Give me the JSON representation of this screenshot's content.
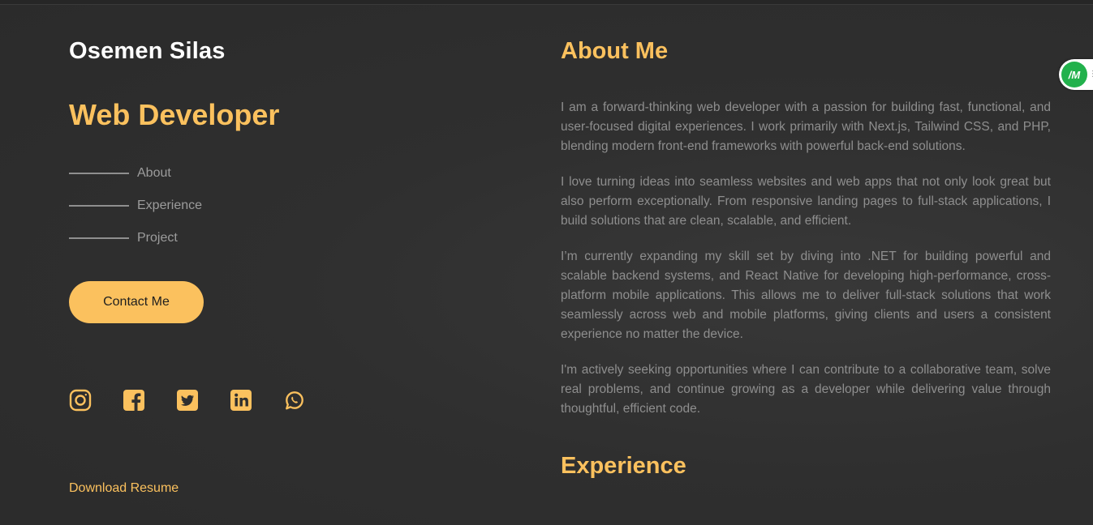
{
  "profile": {
    "name": "Osemen Silas",
    "role": "Web Developer"
  },
  "nav": {
    "items": [
      {
        "label": "About"
      },
      {
        "label": "Experience"
      },
      {
        "label": "Project"
      }
    ]
  },
  "contact": {
    "label": "Contact Me"
  },
  "socials": [
    {
      "icon": "instagram-icon"
    },
    {
      "icon": "facebook-icon"
    },
    {
      "icon": "twitter-icon"
    },
    {
      "icon": "linkedin-icon"
    },
    {
      "icon": "whatsapp-icon"
    }
  ],
  "resume": {
    "label": "Download Resume"
  },
  "about": {
    "title": "About Me",
    "paragraphs": [
      "I am a forward-thinking web developer with a passion for building fast, functional, and user-focused digital experiences. I work primarily with Next.js, Tailwind CSS, and PHP, blending modern front-end frameworks with powerful back-end solutions.",
      "I love turning ideas into seamless websites and web apps that not only look great but also perform exceptionally. From responsive landing pages to full-stack applications, I build solutions that are clean, scalable, and efficient.",
      "I’m currently expanding my skill set by diving into .NET for building powerful and scalable backend systems, and React Native for developing high-performance, cross-platform mobile applications. This allows me to deliver full-stack solutions that work seamlessly across web and mobile platforms, giving clients and users a consistent experience no matter the device.",
      "I'm actively seeking opportunities where I can contribute to a collaborative team, solve real problems, and continue growing as a developer while delivering value through thoughtful, efficient code."
    ]
  },
  "experience": {
    "title": "Experience"
  },
  "extension": {
    "badge": "/M"
  },
  "colors": {
    "accent": "#fbc15e",
    "background": "#2f2f2f",
    "body_text": "#8e8e8e",
    "nav_text": "#9c9c9c"
  }
}
